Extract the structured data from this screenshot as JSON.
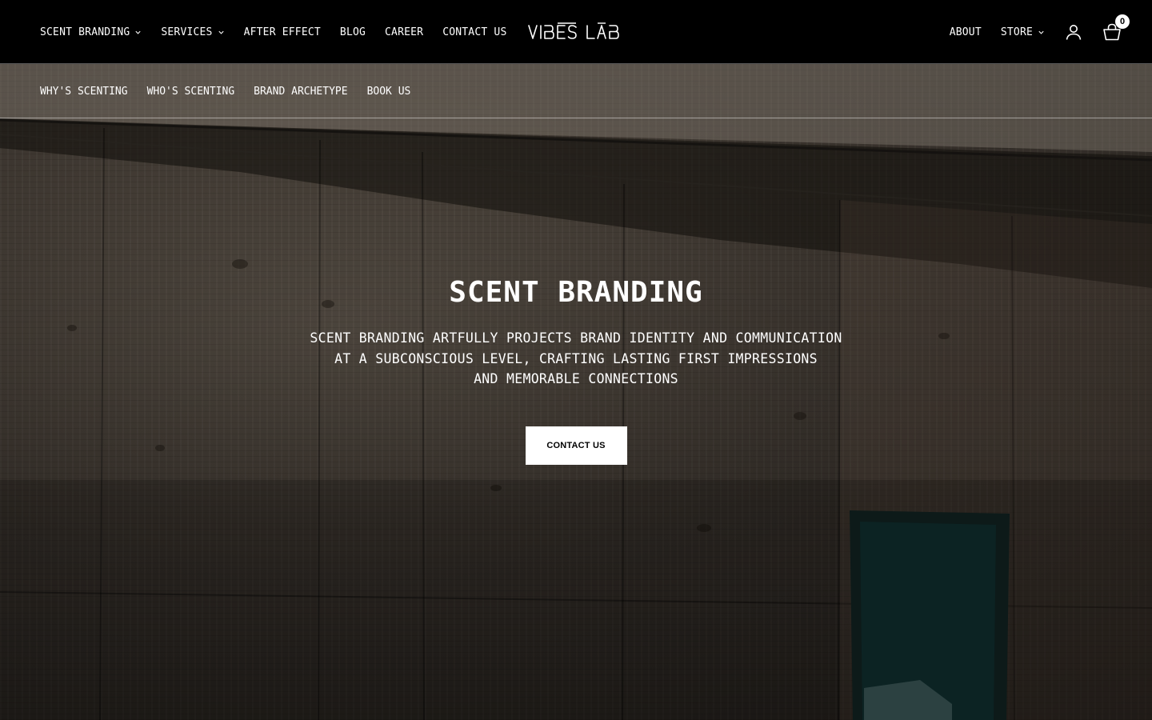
{
  "header": {
    "logo_text": "VIBES LAB",
    "nav_left": [
      {
        "label": "SCENT BRANDING",
        "has_dropdown": true
      },
      {
        "label": "SERVICES",
        "has_dropdown": true
      },
      {
        "label": "AFTER EFFECT",
        "has_dropdown": false
      },
      {
        "label": "BLOG",
        "has_dropdown": false
      },
      {
        "label": "CAREER",
        "has_dropdown": false
      },
      {
        "label": "CONTACT US",
        "has_dropdown": false
      }
    ],
    "nav_right": [
      {
        "label": "ABOUT",
        "has_dropdown": false
      },
      {
        "label": "STORE",
        "has_dropdown": true
      }
    ],
    "icons": {
      "account": "user-icon",
      "cart": "cart-icon"
    },
    "cart_count": "0"
  },
  "subnav": {
    "items": [
      {
        "label": "WHY'S SCENTING"
      },
      {
        "label": "WHO'S SCENTING"
      },
      {
        "label": "BRAND ARCHETYPE"
      },
      {
        "label": "BOOK US"
      }
    ]
  },
  "hero": {
    "title": "SCENT BRANDING",
    "description_lines": [
      "SCENT BRANDING ARTFULLY PROJECTS BRAND IDENTITY AND COMMUNICATION",
      "AT A SUBCONSCIOUS LEVEL, CRAFTING LASTING FIRST IMPRESSIONS",
      "AND MEMORABLE CONNECTIONS"
    ],
    "cta_label": "CONTACT US"
  },
  "colors": {
    "header_bg": "#000000",
    "text": "#ffffff",
    "cta_bg": "#ffffff",
    "cta_text": "#000000"
  }
}
